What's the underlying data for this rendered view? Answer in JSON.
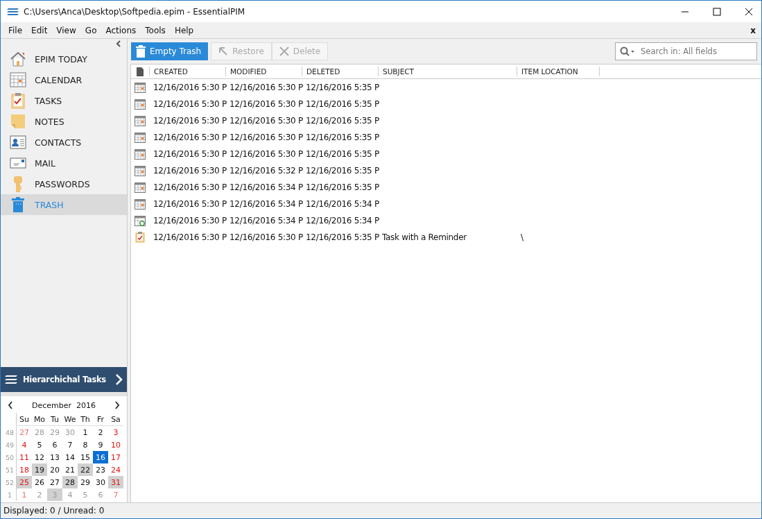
{
  "window": {
    "title": "C:\\Users\\Anca\\Desktop\\Softpedia.epim - EssentialPIM"
  },
  "menu": [
    "File",
    "Edit",
    "View",
    "Go",
    "Actions",
    "Tools",
    "Help"
  ],
  "menu_close": "x",
  "sidebar": {
    "items": [
      {
        "label": "EPIM TODAY",
        "kind": "today",
        "selected": false
      },
      {
        "label": "CALENDAR",
        "kind": "calendar",
        "selected": false
      },
      {
        "label": "TASKS",
        "kind": "tasks",
        "selected": false
      },
      {
        "label": "NOTES",
        "kind": "notes",
        "selected": false
      },
      {
        "label": "CONTACTS",
        "kind": "contacts",
        "selected": false
      },
      {
        "label": "MAIL",
        "kind": "mail",
        "selected": false
      },
      {
        "label": "PASSWORDS",
        "kind": "passwords",
        "selected": false
      },
      {
        "label": "TRASH",
        "kind": "trash",
        "selected": true
      }
    ],
    "panel_button": "Hierarchichal Tasks"
  },
  "mini_calendar": {
    "month": "December",
    "year": "2016",
    "weekdays": [
      "Su",
      "Mo",
      "Tu",
      "We",
      "Th",
      "Fr",
      "Sa"
    ],
    "weeks": [
      {
        "number": "48",
        "days": [
          {
            "day": "27",
            "other_month": true,
            "weekend": true,
            "marked": false,
            "selected": false
          },
          {
            "day": "28",
            "other_month": true,
            "weekend": false,
            "marked": false,
            "selected": false
          },
          {
            "day": "29",
            "other_month": true,
            "weekend": false,
            "marked": false,
            "selected": false
          },
          {
            "day": "30",
            "other_month": true,
            "weekend": false,
            "marked": false,
            "selected": false
          },
          {
            "day": "1",
            "other_month": false,
            "weekend": false,
            "marked": false,
            "selected": false
          },
          {
            "day": "2",
            "other_month": false,
            "weekend": false,
            "marked": false,
            "selected": false
          },
          {
            "day": "3",
            "other_month": false,
            "weekend": true,
            "marked": false,
            "selected": false
          }
        ]
      },
      {
        "number": "49",
        "days": [
          {
            "day": "4",
            "other_month": false,
            "weekend": true,
            "marked": false,
            "selected": false
          },
          {
            "day": "5",
            "other_month": false,
            "weekend": false,
            "marked": false,
            "selected": false
          },
          {
            "day": "6",
            "other_month": false,
            "weekend": false,
            "marked": false,
            "selected": false
          },
          {
            "day": "7",
            "other_month": false,
            "weekend": false,
            "marked": false,
            "selected": false
          },
          {
            "day": "8",
            "other_month": false,
            "weekend": false,
            "marked": false,
            "selected": false
          },
          {
            "day": "9",
            "other_month": false,
            "weekend": false,
            "marked": false,
            "selected": false
          },
          {
            "day": "10",
            "other_month": false,
            "weekend": true,
            "marked": false,
            "selected": false
          }
        ]
      },
      {
        "number": "50",
        "days": [
          {
            "day": "11",
            "other_month": false,
            "weekend": true,
            "marked": false,
            "selected": false
          },
          {
            "day": "12",
            "other_month": false,
            "weekend": false,
            "marked": false,
            "selected": false
          },
          {
            "day": "13",
            "other_month": false,
            "weekend": false,
            "marked": false,
            "selected": false
          },
          {
            "day": "14",
            "other_month": false,
            "weekend": false,
            "marked": false,
            "selected": false
          },
          {
            "day": "15",
            "other_month": false,
            "weekend": false,
            "marked": false,
            "selected": false
          },
          {
            "day": "16",
            "other_month": false,
            "weekend": false,
            "marked": false,
            "selected": true
          },
          {
            "day": "17",
            "other_month": false,
            "weekend": true,
            "marked": false,
            "selected": false
          }
        ]
      },
      {
        "number": "51",
        "days": [
          {
            "day": "18",
            "other_month": false,
            "weekend": true,
            "marked": false,
            "selected": false
          },
          {
            "day": "19",
            "other_month": false,
            "weekend": false,
            "marked": true,
            "selected": false
          },
          {
            "day": "20",
            "other_month": false,
            "weekend": false,
            "marked": false,
            "selected": false
          },
          {
            "day": "21",
            "other_month": false,
            "weekend": false,
            "marked": false,
            "selected": false
          },
          {
            "day": "22",
            "other_month": false,
            "weekend": false,
            "marked": true,
            "selected": false
          },
          {
            "day": "23",
            "other_month": false,
            "weekend": false,
            "marked": false,
            "selected": false
          },
          {
            "day": "24",
            "other_month": false,
            "weekend": true,
            "marked": false,
            "selected": false
          }
        ]
      },
      {
        "number": "52",
        "days": [
          {
            "day": "25",
            "other_month": false,
            "weekend": true,
            "marked": true,
            "selected": false
          },
          {
            "day": "26",
            "other_month": false,
            "weekend": false,
            "marked": false,
            "selected": false
          },
          {
            "day": "27",
            "other_month": false,
            "weekend": false,
            "marked": false,
            "selected": false
          },
          {
            "day": "28",
            "other_month": false,
            "weekend": false,
            "marked": true,
            "selected": false
          },
          {
            "day": "29",
            "other_month": false,
            "weekend": false,
            "marked": false,
            "selected": false
          },
          {
            "day": "30",
            "other_month": false,
            "weekend": false,
            "marked": false,
            "selected": false
          },
          {
            "day": "31",
            "other_month": false,
            "weekend": true,
            "marked": true,
            "selected": false
          }
        ]
      },
      {
        "number": "1",
        "days": [
          {
            "day": "1",
            "other_month": true,
            "weekend": true,
            "marked": false,
            "selected": false
          },
          {
            "day": "2",
            "other_month": true,
            "weekend": false,
            "marked": false,
            "selected": false
          },
          {
            "day": "3",
            "other_month": true,
            "weekend": false,
            "marked": true,
            "selected": false
          },
          {
            "day": "4",
            "other_month": true,
            "weekend": false,
            "marked": false,
            "selected": false
          },
          {
            "day": "5",
            "other_month": true,
            "weekend": false,
            "marked": false,
            "selected": false
          },
          {
            "day": "6",
            "other_month": true,
            "weekend": false,
            "marked": false,
            "selected": false
          },
          {
            "day": "7",
            "other_month": true,
            "weekend": true,
            "marked": false,
            "selected": false
          }
        ]
      }
    ]
  },
  "toolbar": [
    {
      "label": "Empty Trash",
      "kind": "empty",
      "disabled": false
    },
    {
      "label": "Restore",
      "kind": "restore",
      "disabled": true
    },
    {
      "label": "Delete",
      "kind": "delete",
      "disabled": true
    }
  ],
  "search": {
    "placeholder": "Search in: All fields"
  },
  "table": {
    "columns": [
      "CREATED",
      "MODIFIED",
      "DELETED",
      "SUBJECT",
      "ITEM LOCATION"
    ],
    "rows": [
      {
        "kind": "event",
        "cells": [
          "12/16/2016 5:30 P",
          "12/16/2016 5:30 P",
          "12/16/2016 5:35 P",
          "",
          ""
        ]
      },
      {
        "kind": "event",
        "cells": [
          "12/16/2016 5:30 P",
          "12/16/2016 5:30 P",
          "12/16/2016 5:35 P",
          "",
          ""
        ]
      },
      {
        "kind": "event",
        "cells": [
          "12/16/2016 5:30 P",
          "12/16/2016 5:30 P",
          "12/16/2016 5:35 P",
          "",
          ""
        ]
      },
      {
        "kind": "event",
        "cells": [
          "12/16/2016 5:30 P",
          "12/16/2016 5:30 P",
          "12/16/2016 5:35 P",
          "",
          ""
        ]
      },
      {
        "kind": "event",
        "cells": [
          "12/16/2016 5:30 P",
          "12/16/2016 5:30 P",
          "12/16/2016 5:35 P",
          "",
          ""
        ]
      },
      {
        "kind": "event",
        "cells": [
          "12/16/2016 5:30 P",
          "12/16/2016 5:32 P",
          "12/16/2016 5:35 P",
          "",
          ""
        ]
      },
      {
        "kind": "event",
        "cells": [
          "12/16/2016 5:30 P",
          "12/16/2016 5:34 P",
          "12/16/2016 5:35 P",
          "",
          ""
        ]
      },
      {
        "kind": "event",
        "cells": [
          "12/16/2016 5:30 P",
          "12/16/2016 5:34 P",
          "12/16/2016 5:34 P",
          "",
          ""
        ]
      },
      {
        "kind": "recurring",
        "cells": [
          "12/16/2016 5:30 P",
          "12/16/2016 5:34 P",
          "12/16/2016 5:34 P",
          "",
          ""
        ]
      },
      {
        "kind": "task",
        "cells": [
          "12/16/2016 5:30 P",
          "12/16/2016 5:30 P",
          "12/16/2016 5:35 P",
          "Task with a Reminder",
          "\\"
        ]
      }
    ]
  },
  "status_bar": "Displayed: 0 / Unread: 0"
}
